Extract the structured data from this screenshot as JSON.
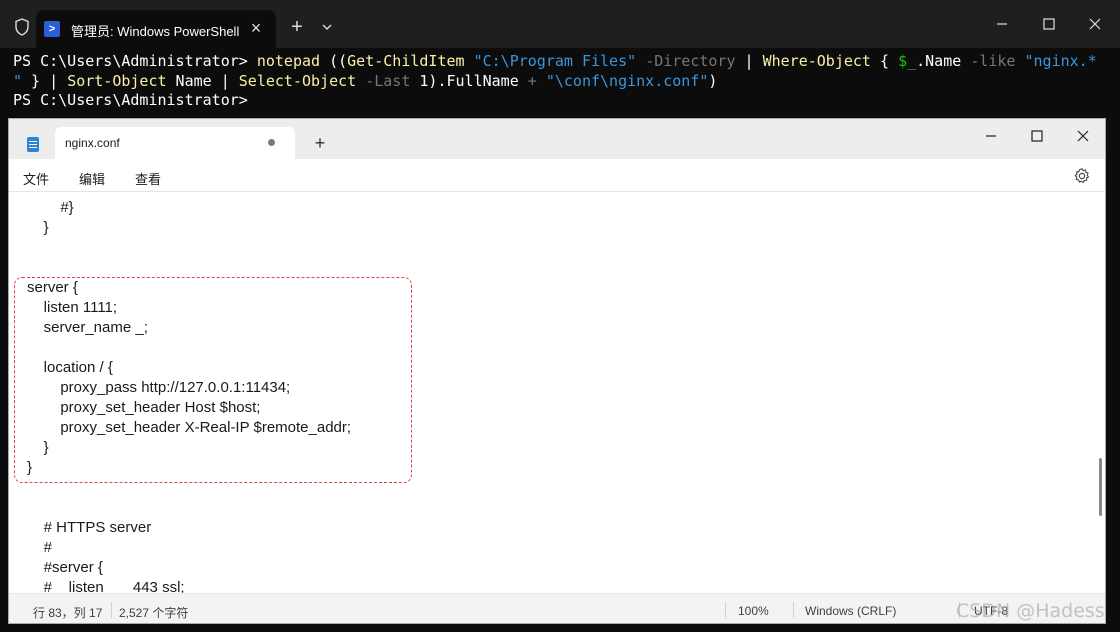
{
  "powershell": {
    "tab_title": "管理员: Windows PowerShell",
    "lines": [
      [
        {
          "t": "PS C:\\Users\\Administrator> ",
          "c": "c-white"
        },
        {
          "t": "notepad",
          "c": "c-yellow"
        },
        {
          "t": " ((",
          "c": "c-white"
        },
        {
          "t": "Get-ChildItem",
          "c": "c-yellow"
        },
        {
          "t": " ",
          "c": "c-white"
        },
        {
          "t": "\"C:\\Program Files\"",
          "c": "c-blue"
        },
        {
          "t": " ",
          "c": "c-white"
        },
        {
          "t": "-Directory",
          "c": "c-gray"
        },
        {
          "t": " | ",
          "c": "c-white"
        },
        {
          "t": "Where-Object",
          "c": "c-yellow"
        },
        {
          "t": " { ",
          "c": "c-white"
        },
        {
          "t": "$_",
          "c": "c-green"
        },
        {
          "t": ".Name ",
          "c": "c-white"
        },
        {
          "t": "-like",
          "c": "c-gray"
        },
        {
          "t": " ",
          "c": "c-white"
        },
        {
          "t": "\"nginx.*",
          "c": "c-blue"
        }
      ],
      [
        {
          "t": "\"",
          "c": "c-blue"
        },
        {
          "t": " } | ",
          "c": "c-white"
        },
        {
          "t": "Sort-Object",
          "c": "c-yellow"
        },
        {
          "t": " Name | ",
          "c": "c-white"
        },
        {
          "t": "Select-Object",
          "c": "c-yellow"
        },
        {
          "t": " ",
          "c": "c-white"
        },
        {
          "t": "-Last",
          "c": "c-gray"
        },
        {
          "t": " 1).FullName ",
          "c": "c-white"
        },
        {
          "t": "+",
          "c": "c-gray"
        },
        {
          "t": " ",
          "c": "c-white"
        },
        {
          "t": "\"\\conf\\nginx.conf\"",
          "c": "c-blue"
        },
        {
          "t": ")",
          "c": "c-white"
        }
      ],
      [
        {
          "t": "PS C:\\Users\\Administrator>",
          "c": "c-white"
        }
      ]
    ]
  },
  "notepad": {
    "tab_title": "nginx.conf",
    "menu": {
      "file": "文件",
      "edit": "编辑",
      "view": "查看"
    },
    "code_lines": [
      "        #}",
      "    }",
      "",
      "",
      "server {",
      "    listen 1111;",
      "    server_name _;",
      "",
      "    location / {",
      "        proxy_pass http://127.0.0.1:11434;",
      "        proxy_set_header Host $host;",
      "        proxy_set_header X-Real-IP $remote_addr;",
      "    }",
      "}",
      "",
      "",
      "    # HTTPS server",
      "    #",
      "    #server {",
      "    #    listen       443 ssl;"
    ],
    "status": {
      "position": "行 83，列 17",
      "chars": "2,527 个字符",
      "zoom": "100%",
      "line_ending": "Windows (CRLF)",
      "encoding": "UTF-8"
    }
  },
  "watermark": "CSDN @Hadess"
}
